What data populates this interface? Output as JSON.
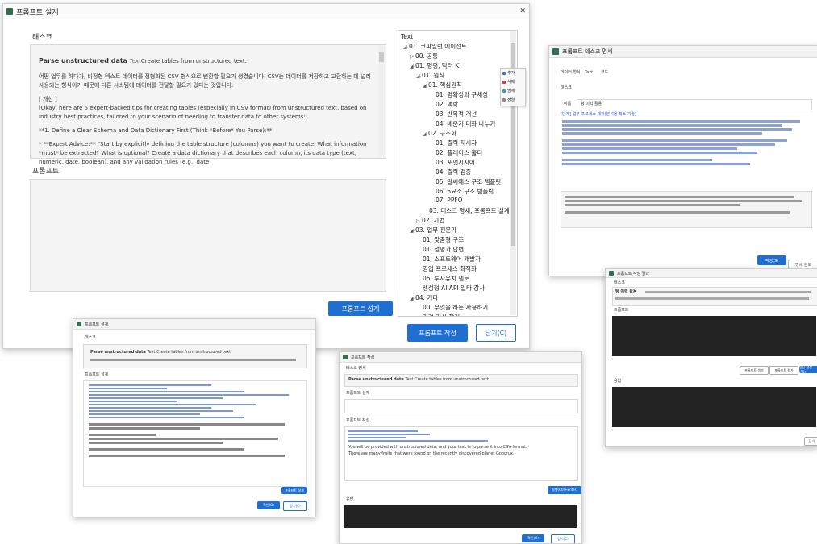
{
  "main_window": {
    "title": "프롬프트 설계",
    "close": "✕",
    "task_label": "태스크",
    "task_heading": "Parse unstructured data",
    "task_heading_tag": "Text",
    "task_heading_desc": "Create tables from unstructured text.",
    "task_para1": "어떤 업무를 하다가, 비정형 텍스트 데이터를 정형화된 CSV 형식으로 변환할 필요가 생겼습니다. CSV는 데이터를 저장하고 교환하는 데 널리 사용되는 형식이기 때문에 다른 시스템에 데이터를 전달할 필요가 있다는 것입니다.",
    "task_para2": "[ 개선 ]",
    "task_para3": "[Okay, here are 5 expert-backed tips for creating tables (especially in CSV format) from unstructured text, based on industry best practices, tailored to your scenario of needing to transfer data to other systems:",
    "task_para4": "**1. Define a Clear Schema and Data Dictionary First (Think *Before* You Parse):**",
    "task_para5": "* **Expert Advice:** \"Start by explicitly defining the table structure (columns) you want to create. What information *must* be extracted? What is optional? Create a data dictionary that describes each column, its data type (text, numeric, date, boolean), and any validation rules (e.g., date",
    "prompt_label": "프롬프트",
    "design_button": "프롬프트 설계",
    "write_button": "프롬프트 작성",
    "close_button": "닫기(C)"
  },
  "tree": {
    "root": "Text",
    "items": [
      {
        "label": "01. 코파일럿 에이전트",
        "glyph": "◢"
      },
      {
        "label": "00. 공통",
        "glyph": "▷"
      },
      {
        "label": "01. 명령, 닥터 K",
        "glyph": "◢"
      },
      {
        "label": "01. 원칙",
        "glyph": "◢"
      },
      {
        "label": "01. 핵심원칙",
        "glyph": "◢"
      },
      {
        "label": "01. 명확성과 구체성",
        "glyph": ""
      },
      {
        "label": "02. 맥락",
        "glyph": ""
      },
      {
        "label": "03. 반복적 개선",
        "glyph": ""
      },
      {
        "label": "04. 배운거 대화 나누기",
        "glyph": ""
      },
      {
        "label": "02. 구조화",
        "glyph": "◢"
      },
      {
        "label": "01. 출력 지시자",
        "glyph": ""
      },
      {
        "label": "02. 플레이스 홀더",
        "glyph": ""
      },
      {
        "label": "03. 포맷지시어",
        "glyph": ""
      },
      {
        "label": "04. 출력 검증",
        "glyph": ""
      },
      {
        "label": "05. 알씨에스 구조 템플릿",
        "glyph": ""
      },
      {
        "label": "06. 6요소 구조 템플릿",
        "glyph": ""
      },
      {
        "label": "07. PPFO",
        "glyph": ""
      },
      {
        "label": "03. 태스크 명세, 프롬프트 설계",
        "glyph": ""
      },
      {
        "label": "02. 기법",
        "glyph": "▷"
      },
      {
        "label": "03. 업무 전문가",
        "glyph": "◢"
      },
      {
        "label": "01. 맞춤형 구조",
        "glyph": ""
      },
      {
        "label": "01. 설명과 답변",
        "glyph": ""
      },
      {
        "label": "01. 소프트웨어 개발자",
        "glyph": ""
      },
      {
        "label": "영업 프로세스 최적화",
        "glyph": ""
      },
      {
        "label": "05. 투자유치 멘토",
        "glyph": ""
      },
      {
        "label": "생성형 AI API 일타 강사",
        "glyph": ""
      },
      {
        "label": "04. 기타",
        "glyph": "◢"
      },
      {
        "label": "00. 무엇을 하든 사용하기",
        "glyph": ""
      },
      {
        "label": "관련 기사 찾기",
        "glyph": ""
      }
    ]
  },
  "context_menu": {
    "items": [
      "추가",
      "삭제",
      "명세",
      "정렬"
    ],
    "colors": [
      "#3a6ed8",
      "#d83a3a",
      "#3a9ad8",
      "#888888"
    ]
  },
  "win_tr": {
    "title": "프롬프트 테스크 명세",
    "type_label": "데이터 형식",
    "type_value": "Text",
    "type_extra": "코드",
    "task_label": "태스크",
    "name_label": "이름",
    "name_value": "텅 이력 활용",
    "body": "[단계] 업무 프로세스 제작(분석을 최소 기술)",
    "save_button": "작성(S)",
    "close_button": "닫기(C)",
    "small_button": "명세 검토"
  },
  "win_mr": {
    "title": "프롬프트 작성 결과",
    "section1": "태스크",
    "section2": "프롬프트",
    "section3": "응답",
    "task_name": "텅 이력 활용",
    "btn1": "프롬프트 생성",
    "btn2": "프롬프트 평가",
    "btn3": "응답 생성(F5)",
    "close": "닫기"
  },
  "win_bl": {
    "title": "프롬프트 설계",
    "task_label": "태스크",
    "heading": "Parse unstructured data",
    "heading_desc": "Text Create tables from unstructured text.",
    "design_label": "프롬프트 설계",
    "design_button": "프롬프트 설계",
    "save_button": "확인(O)",
    "close_button": "닫기(C)"
  },
  "win_bc": {
    "title": "프롬프트 작성",
    "task_label": "태스크 명세",
    "heading": "Parse unstructured data",
    "heading_desc": "Text Create tables from unstructured text.",
    "design_label": "프롬프트 설계",
    "write_label": "프롬프트 작성",
    "prompt_text": "You will be provided with unstructured data, and your task is to parse it into CSV format.",
    "prompt_text2": "There are many fruits that were found on the recently discovered planet Goocrux.",
    "response_label": "응답",
    "ask_button": "실행(Ctrl+Enter)",
    "save_button": "확인(O)",
    "close_button": "닫기(C)"
  }
}
